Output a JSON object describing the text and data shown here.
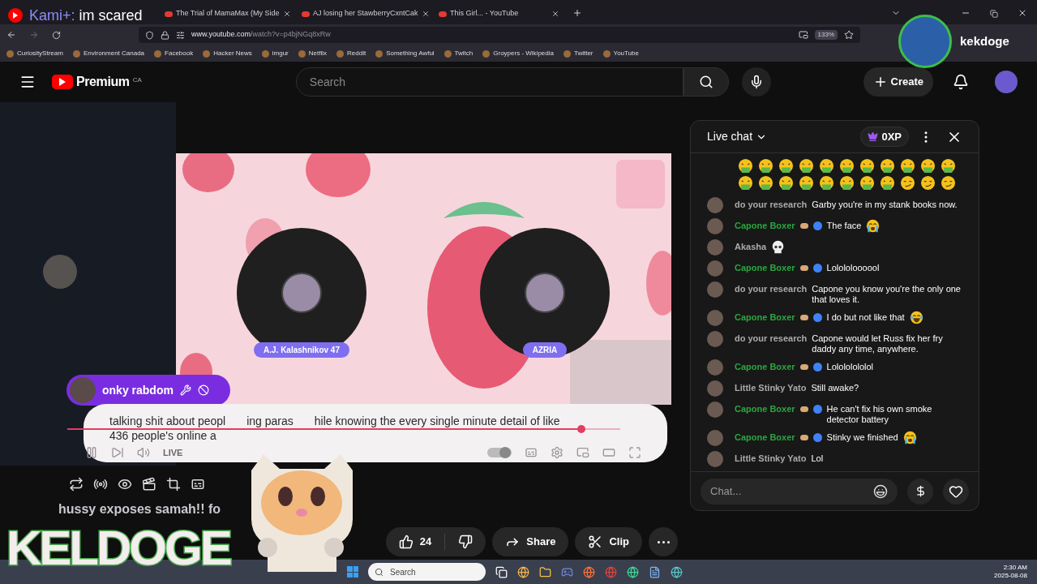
{
  "overlay_alert": {
    "user": "Kami+:",
    "message": "im scared"
  },
  "browser": {
    "tabs": [
      {
        "title": "The Trial of MamaMax (My Side",
        "selected": false
      },
      {
        "title": "AJ losing her StawberryCxntCak",
        "selected": false
      },
      {
        "title": "This Girl... - YouTube",
        "selected": false
      }
    ],
    "url_host": "www.youtube.com",
    "url_path": "/watch?v=p4bjNGq8xRw",
    "zoom": "133%",
    "bookmarks": [
      "CuriosityStream",
      "Environment Canada",
      "Facebook",
      "Hacker News",
      "imgur",
      "Netflix",
      "Reddit",
      "Something Awful",
      "Twitch",
      "Groypers - Wikipedia",
      "Twitter",
      "YouTube"
    ]
  },
  "streamer_badge": {
    "name": "kekdoge"
  },
  "youtube": {
    "logo": "Premium",
    "region": "CA",
    "search_placeholder": "Search",
    "create": "Create"
  },
  "video": {
    "participants": [
      {
        "name": "A.J. Kalashnikov 47"
      },
      {
        "name": "AZRIA"
      }
    ],
    "caption_lines": [
      [
        "talking shit about peopl",
        "ing paras",
        "hile knowing the every single minute detail of like"
      ],
      [
        "436 people's online a"
      ]
    ],
    "live_label": "LIVE",
    "progress": {
      "level": 0.93
    },
    "autoplay": {
      "on": true
    }
  },
  "chat_overlay": {
    "name": "onky rabdom"
  },
  "title": "hussy exposes samah!! fo",
  "actions": {
    "likes": "24",
    "share": "Share",
    "clip": "Clip"
  },
  "logo_overlay": "KELDOGE",
  "chat": {
    "title": "Live chat",
    "xp": "0XP",
    "emote_rows": [
      [
        {
          "kind": "vomit"
        },
        {
          "kind": "vomit"
        },
        {
          "kind": "vomit"
        },
        {
          "kind": "vomit"
        },
        {
          "kind": "vomit"
        },
        {
          "kind": "vomit"
        },
        {
          "kind": "vomit"
        },
        {
          "kind": "vomit"
        },
        {
          "kind": "vomit"
        },
        {
          "kind": "vomit"
        },
        {
          "kind": "vomit"
        }
      ],
      [
        {
          "kind": "vomit"
        },
        {
          "kind": "vomit"
        },
        {
          "kind": "vomit"
        },
        {
          "kind": "vomit"
        },
        {
          "kind": "vomit"
        },
        {
          "kind": "vomit"
        },
        {
          "kind": "vomit"
        },
        {
          "kind": "vomit"
        },
        {
          "kind": "smirk"
        },
        {
          "kind": "smirk"
        },
        {
          "kind": "smirk"
        }
      ]
    ],
    "messages": [
      {
        "author": "do your research",
        "member": false,
        "text": "Garby you're in my stank books now."
      },
      {
        "author": "Capone Boxer",
        "member": true,
        "text": "The face",
        "emoji": {
          "kind": "crying"
        }
      },
      {
        "author": "Akasha",
        "member": false,
        "emoji": {
          "kind": "skull"
        }
      },
      {
        "author": "Capone Boxer",
        "member": true,
        "text": "Lolololoooool"
      },
      {
        "author": "do your research",
        "member": false,
        "text": "Capone you know you're the only one that loves it."
      },
      {
        "author": "Capone Boxer",
        "member": true,
        "text": "I do but not like that",
        "emoji": {
          "kind": "laughing"
        }
      },
      {
        "author": "do your research",
        "member": false,
        "text": "Capone would let Russ fix her fry daddy any time, anywhere."
      },
      {
        "author": "Capone Boxer",
        "member": true,
        "text": "Lolololololol"
      },
      {
        "author": "Little Stinky Yato",
        "member": false,
        "text": "Still awake?"
      },
      {
        "author": "Capone Boxer",
        "member": true,
        "text": "He can't fix his own smoke detector battery"
      },
      {
        "author": "Capone Boxer",
        "member": true,
        "text": "Stinky we finished",
        "emoji": {
          "kind": "crying"
        }
      },
      {
        "author": "Little Stinky Yato",
        "member": false,
        "text": "Lol"
      }
    ],
    "placeholder": "Chat..."
  },
  "taskbar": {
    "search": "Search",
    "time": "2:30 AM",
    "date": "2025-08-08"
  }
}
